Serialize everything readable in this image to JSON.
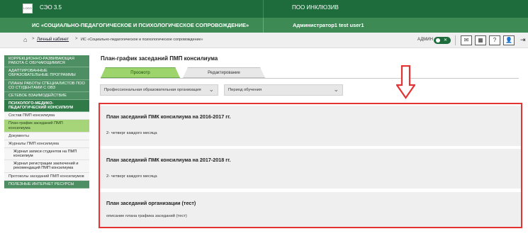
{
  "header": {
    "logo_text": "LOGO",
    "app_name": "СЭО 3.5",
    "org_name": "ПОО ИНКЛЮЗИВ",
    "system_title": "ИС «СОЦИАЛЬНО-ПЕДАГОГИЧЕСКОЕ И ПСИХОЛОГИЧЕСКОЕ СОПРОВОЖДЕНИЕ»",
    "user_name": "Администратор1 test user1"
  },
  "breadcrumb": {
    "home_icon": "home-icon",
    "sep": ">",
    "link": "Личный кабинет",
    "current": "ИС «Социально-педагогическое и психологическое сопровождение»"
  },
  "toolbar": {
    "admin_label": "АДМИН",
    "toggle_on": true,
    "icons": [
      "mail-icon",
      "calendar-icon",
      "help-icon",
      "profile-icon",
      "logout-icon"
    ]
  },
  "sidebar": {
    "items": [
      {
        "label": "КОРРЕКЦИОННО-РАЗВИВАЮЩАЯ РАБОТА С ОБУЧАЮЩИМИСЯ"
      },
      {
        "label": "АДАПТИРОВАННЫЕ ОБРАЗОВАТЕЛЬНЫЕ ПРОГРАММЫ"
      },
      {
        "label": "ПЛАНЫ РАБОТЫ СПЕЦИАЛИСТОВ ПОО СО СТУДЕНТАМИ С ОВЗ"
      },
      {
        "label": "СЕТЕВОЕ ВЗАИМОДЕЙСТВИЕ"
      },
      {
        "label": "ПСИХОЛОГО-МЕДИКО-ПЕДАГОГИЧЕСКИЙ КОНСИЛИУМ"
      },
      {
        "label": "Состав ПМП консилиума"
      },
      {
        "label": "План-график заседаний ПМП консилиума"
      },
      {
        "label": "Документы"
      },
      {
        "label": "Журналы ПМП консилиума"
      },
      {
        "label": "Журнал записи студентов на ПМП консилиум"
      },
      {
        "label": "Журнал регистрации заключений и рекомендаций ПМП консилиума"
      },
      {
        "label": "Протоколы заседаний ПМП консилиумов"
      },
      {
        "label": "ПОЛЕЗНЫЕ ИНТЕРНЕТ РЕСУРСЫ"
      }
    ]
  },
  "page": {
    "title": "План-график заседаний ПМП консилиума",
    "tabs": [
      {
        "label": "Просмотр"
      },
      {
        "label": "Редактирование"
      }
    ],
    "filters": {
      "org_placeholder": "Профессиональная образовательная организация",
      "period_placeholder": "Период обучения"
    }
  },
  "plans": [
    {
      "title": "План заседаний ПМК консилиума на 2016-2017 гг.",
      "desc": "2- четверг каждого месяца"
    },
    {
      "title": "План заседаний ПМК консилиума на 2017-2018 гг.",
      "desc": "2- четверг каждого месяца"
    },
    {
      "title": "План заседаний организации (тест)",
      "desc": "описание плана графика заседаний (тест)"
    }
  ],
  "colors": {
    "top_green": "#1e6b3c",
    "system_green": "#3d8a55",
    "tab_green": "#9dd46c",
    "highlight_red": "#e33333"
  }
}
